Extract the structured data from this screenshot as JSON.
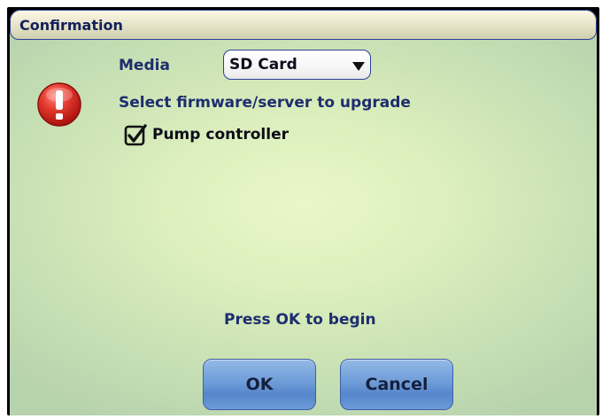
{
  "dialog": {
    "title": "Confirmation",
    "media_label": "Media",
    "media_select": {
      "selected": "SD Card"
    },
    "instruction": "Select firmware/server to upgrade",
    "options": [
      {
        "label": "Pump controller",
        "checked": true
      }
    ],
    "prompt": "Press OK to begin",
    "ok_label": "OK",
    "cancel_label": "Cancel"
  },
  "icons": {
    "warning": "warning-exclamation-icon",
    "dropdown": "chevron-down-icon",
    "checkbox": "checkbox-checked-icon"
  },
  "colors": {
    "text": "#1e2d6e",
    "button": "#6f9dd8",
    "warning": "#d9231e",
    "titlebar_border": "#2a3f9a"
  }
}
